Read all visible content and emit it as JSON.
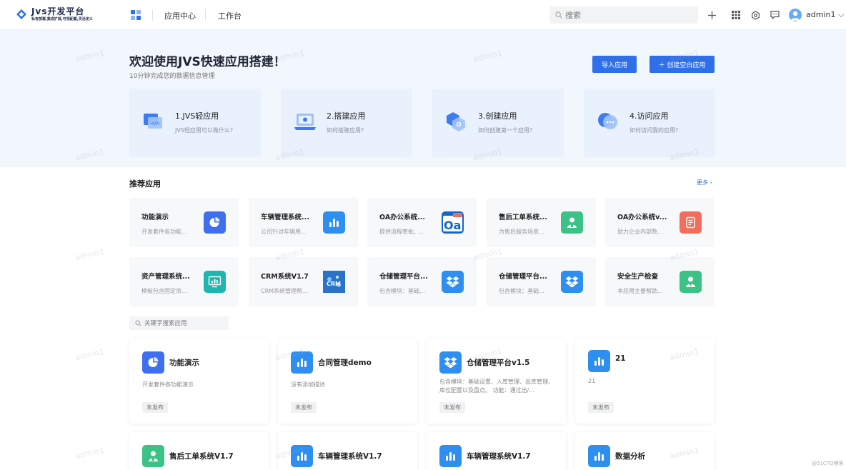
{
  "header": {
    "logo_title": "Jvs开发平台",
    "logo_sub": "私有部署,集成扩展,可视配置,灵活定义",
    "nav": [
      "应用中心",
      "工作台"
    ],
    "search_placeholder": "搜索",
    "user": "admin1",
    "icons": [
      "plus-icon",
      "apps-grid-icon",
      "settings-icon",
      "message-icon",
      "avatar"
    ]
  },
  "hero": {
    "title": "欢迎使用JVS快速应用搭建！",
    "subtitle": "10分钟完成您的数据信息管理",
    "import_label": "导入应用",
    "create_label": "＋ 创建空白应用",
    "steps": [
      {
        "title": "1.JVS轻应用",
        "desc": "JVS轻应用可以做什么?"
      },
      {
        "title": "2.搭建应用",
        "desc": "如何搭建应用?"
      },
      {
        "title": "3.创建应用",
        "desc": "如何创建第一个应用?"
      },
      {
        "title": "4.访问应用",
        "desc": "如何访问我的应用?"
      }
    ]
  },
  "recommend": {
    "title": "推荐应用",
    "more": "更多 ›",
    "items": [
      {
        "name": "功能演示",
        "desc": "开发套件各功能...",
        "icon": "pie-chart-icon",
        "color": "#3e6ff0"
      },
      {
        "name": "车辆管理系统...",
        "desc": "公司针对车辆用...",
        "icon": "bar-chart-icon",
        "color": "#2e8ff0"
      },
      {
        "name": "OA办公系统...",
        "desc": "提供流程审批、...",
        "icon": "oa-logo-icon",
        "color": "#1166cc"
      },
      {
        "name": "售后工单系统...",
        "desc": "为售后服务场景...",
        "icon": "service-person-icon",
        "color": "#3cc286"
      },
      {
        "name": "OA办公系统v...",
        "desc": "助力企业内部数...",
        "icon": "document-icon",
        "color": "#f26d5b"
      },
      {
        "name": "资产管理系统...",
        "desc": "模板包含固定资...",
        "icon": "monitor-icon",
        "color": "#1fb5b0"
      },
      {
        "name": "CRM系统V1.7",
        "desc": "CRM系统管理帮...",
        "icon": "crm-image-icon",
        "color": "#2a73c8"
      },
      {
        "name": "仓储管理平台...",
        "desc": "包含模块：基础...",
        "icon": "dropbox-icon",
        "color": "#2e8ff0"
      },
      {
        "name": "仓储管理平台...",
        "desc": "包含模块：基础...",
        "icon": "dropbox-icon",
        "color": "#2e8ff0"
      },
      {
        "name": "安全生产检查",
        "desc": "本应用主要帮助...",
        "icon": "safety-person-icon",
        "color": "#3cc286"
      }
    ]
  },
  "app_search_placeholder": "关键字搜索应用",
  "apps": [
    {
      "name": "功能演示",
      "desc": "开发套件各功能演示",
      "badge": "未发布",
      "icon": "pie-chart-icon",
      "color": "#3e6ff0"
    },
    {
      "name": "合同管理demo",
      "desc": "没有添加描述",
      "badge": "未发布",
      "icon": "bar-chart-icon",
      "color": "#2e8ff0"
    },
    {
      "name": "仓储管理平台v1.5",
      "desc": "包含模块：基础设置、入库管理、出库管理、库位配置以及盘点。 功能：通过出/...",
      "badge": "未发布",
      "icon": "dropbox-icon",
      "color": "#2e8ff0"
    },
    {
      "name": "21",
      "desc": "21",
      "badge": "未发布",
      "icon": "bar-chart-icon",
      "color": "#2e8ff0"
    },
    {
      "name": "售后工单系统V1.7",
      "icon": "service-person-icon",
      "color": "#3cc286"
    },
    {
      "name": "车辆管理系统V1.7",
      "icon": "bar-chart-icon",
      "color": "#2e8ff0"
    },
    {
      "name": "车辆管理系统V1.7",
      "icon": "bar-chart-icon",
      "color": "#2e8ff0"
    },
    {
      "name": "数据分析",
      "icon": "bar-chart-icon",
      "color": "#2e8ff0"
    }
  ],
  "watermark": "admin1",
  "corner_mark": "@51CTO博客"
}
